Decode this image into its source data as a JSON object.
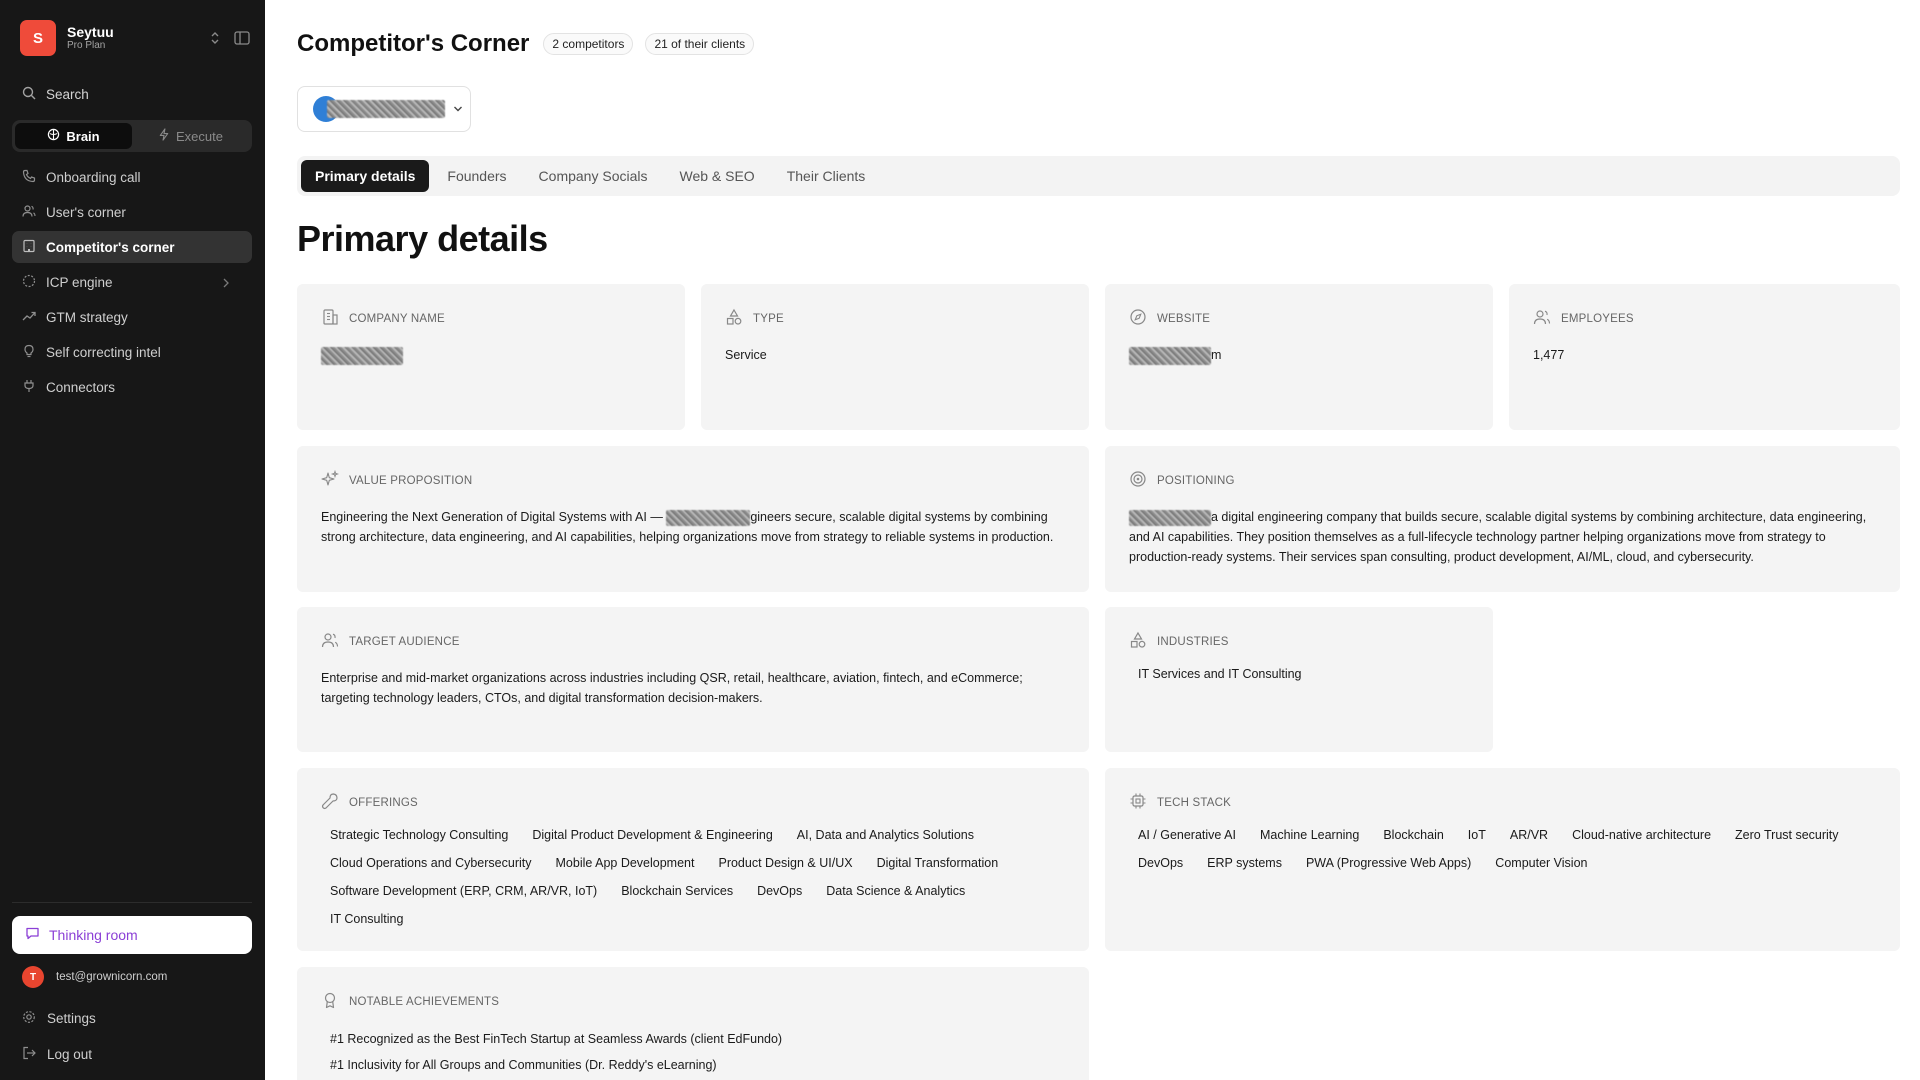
{
  "sidebar": {
    "workspace": {
      "initial": "S",
      "name": "Seytuu",
      "plan": "Pro Plan"
    },
    "search_label": "Search",
    "modes": [
      {
        "label": "Brain",
        "active": true,
        "icon": "brain-icon"
      },
      {
        "label": "Execute",
        "active": false,
        "icon": "bolt-icon"
      }
    ],
    "items": [
      {
        "label": "Onboarding call",
        "icon": "phone-icon"
      },
      {
        "label": "User's corner",
        "icon": "users-icon"
      },
      {
        "label": "Competitor's corner",
        "icon": "building-icon",
        "active": true
      },
      {
        "label": "ICP engine",
        "icon": "target-icon",
        "has_children": true
      },
      {
        "label": "GTM strategy",
        "icon": "trend-icon"
      },
      {
        "label": "Self correcting intel",
        "icon": "bulb-icon"
      },
      {
        "label": "Connectors",
        "icon": "plug-icon"
      }
    ],
    "thinking_room": "Thinking room",
    "user": {
      "initial": "T",
      "email": "test@grownicorn.com"
    },
    "settings": "Settings",
    "logout": "Log out"
  },
  "header": {
    "title": "Competitor's Corner",
    "badges": [
      "2 competitors",
      "21 of their clients"
    ]
  },
  "tabs": [
    {
      "label": "Primary details",
      "active": true
    },
    {
      "label": "Founders"
    },
    {
      "label": "Company Socials"
    },
    {
      "label": "Web & SEO"
    },
    {
      "label": "Their Clients"
    }
  ],
  "section_title": "Primary details",
  "cards": {
    "company_name": {
      "label": "COMPANY NAME"
    },
    "type": {
      "label": "TYPE",
      "value": "Service"
    },
    "website": {
      "label": "WEBSITE",
      "value_suffix": "m"
    },
    "employees": {
      "label": "EMPLOYEES",
      "value": "1,477"
    },
    "value_proposition": {
      "label": "VALUE PROPOSITION",
      "text_before": "Engineering the Next Generation of Digital Systems with AI — ",
      "text_after": "gineers secure, scalable digital systems by combining strong architecture, data engineering, and AI capabilities, helping organizations move from strategy to reliable systems in production."
    },
    "positioning": {
      "label": "POSITIONING",
      "text_after": "a digital engineering company that builds secure, scalable digital systems by combining architecture, data engineering, and AI capabilities. They position themselves as a full-lifecycle technology partner helping organizations move from strategy to production-ready systems. Their services span consulting, product development, AI/ML, cloud, and cybersecurity."
    },
    "target_audience": {
      "label": "TARGET AUDIENCE",
      "value": "Enterprise and mid-market organizations across industries including QSR, retail, healthcare, aviation, fintech, and eCommerce; targeting technology leaders, CTOs, and digital transformation decision-makers."
    },
    "industries": {
      "label": "INDUSTRIES",
      "tags": [
        "IT Services and IT Consulting"
      ]
    },
    "offerings": {
      "label": "OFFERINGS",
      "tags": [
        "Strategic Technology Consulting",
        "Digital Product Development & Engineering",
        "AI, Data and Analytics Solutions",
        "Cloud Operations and Cybersecurity",
        "Mobile App Development",
        "Product Design & UI/UX",
        "Digital Transformation",
        "Software Development (ERP, CRM, AR/VR, IoT)",
        "Blockchain Services",
        "DevOps",
        "Data Science & Analytics",
        "IT Consulting"
      ]
    },
    "tech_stack": {
      "label": "TECH STACK",
      "tags": [
        "AI / Generative AI",
        "Machine Learning",
        "Blockchain",
        "IoT",
        "AR/VR",
        "Cloud-native architecture",
        "Zero Trust security",
        "DevOps",
        "ERP systems",
        "PWA (Progressive Web Apps)",
        "Computer Vision"
      ]
    },
    "achievements": {
      "label": "NOTABLE ACHIEVEMENTS",
      "items": [
        "#1 Recognized as the Best FinTech Startup at Seamless Awards (client EdFundo)",
        "#1 Inclusivity for All Groups and Communities (Dr. Reddy's eLearning)"
      ]
    }
  }
}
